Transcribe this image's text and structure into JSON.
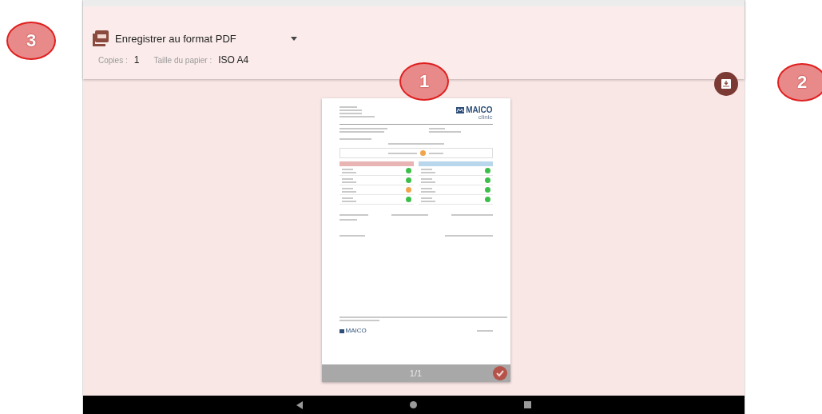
{
  "print_header": {
    "printer": "Enregistrer au format PDF",
    "copies_label": "Copies :",
    "copies": "1",
    "paper_label": "Taille du papier :",
    "paper": "ISO A4"
  },
  "preview": {
    "logo": "MAICO",
    "logo_sub": "clinic",
    "summary_passed": false,
    "footer_logo": "MAICO",
    "page_indicator": "1/1",
    "selected": true,
    "left_results": [
      {
        "passed": true
      },
      {
        "passed": true
      },
      {
        "passed": false
      },
      {
        "passed": true
      }
    ],
    "right_results": [
      {
        "passed": true
      },
      {
        "passed": true
      },
      {
        "passed": true
      },
      {
        "passed": true
      }
    ]
  },
  "annotations": [
    {
      "label": "3"
    },
    {
      "label": "1"
    },
    {
      "label": "2"
    }
  ]
}
